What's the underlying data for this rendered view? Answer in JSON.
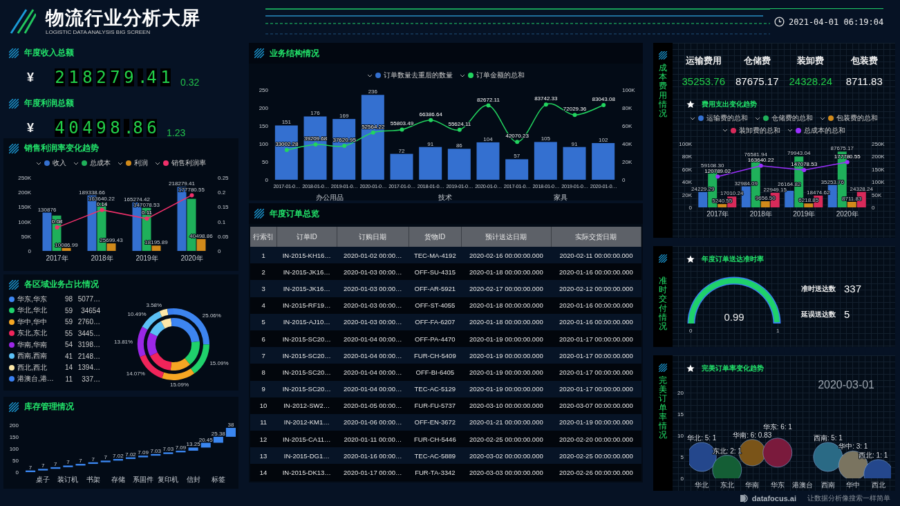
{
  "header": {
    "title": "物流行业分析大屏",
    "subtitle": "LOGISTIC DATA ANALYSIS BIG SCREEN",
    "datetime": "2021-04-01 06:19:04"
  },
  "kpis": [
    {
      "title": "年度收入总额",
      "currency": "¥",
      "value": "218279.41",
      "ratio": "0.32"
    },
    {
      "title": "年度利润总额",
      "currency": "¥",
      "value": "40498.86",
      "ratio": "1.23"
    }
  ],
  "sales_trend": {
    "title": "销售利润率变化趋势",
    "chart_data": {
      "type": "bar",
      "categories": [
        "2017年",
        "2018年",
        "2019年",
        "2020年"
      ],
      "ylim": [
        0,
        250000
      ],
      "yticks": [
        {
          "value": 0,
          "label": "0"
        },
        {
          "value": 50000,
          "label": "50K"
        },
        {
          "value": 100000,
          "label": "100K"
        },
        {
          "value": 150000,
          "label": "150K"
        },
        {
          "value": 200000,
          "label": "200K"
        },
        {
          "value": 250000,
          "label": "250K"
        }
      ],
      "y2lim": [
        0,
        0.25
      ],
      "y2ticks": [
        0,
        0.05,
        0.1,
        0.15,
        0.2,
        0.25
      ],
      "series": [
        {
          "name": "收入",
          "color": "#3470d0",
          "values": [
            130876,
            189338.66,
            165274.42,
            218279.41
          ],
          "value_labels": [
            "130876",
            "189338.66",
            "165274.42",
            "218279.41"
          ]
        },
        {
          "name": "总成本",
          "color": "#1fb05a",
          "values": [
            120789.02,
            163640.22,
            147078.53,
            177780.55
          ],
          "value_labels": [
            null,
            "163640.22",
            "147078.53",
            "177780.55"
          ]
        },
        {
          "name": "利润",
          "color": "#d18a1a",
          "values": [
            10086.99,
            25699.43,
            18195.89,
            40498.86
          ],
          "value_labels": [
            "10086.99",
            "25699.43",
            "18195.89",
            "40498.86"
          ]
        },
        {
          "name": "销售利润率",
          "type": "line",
          "axis": "y2",
          "marker": true,
          "color": "#f0306a",
          "values": [
            0.08,
            0.14,
            0.11,
            0.19
          ],
          "value_labels": [
            "0.08",
            "0.14",
            "0.11",
            null
          ]
        }
      ]
    }
  },
  "regions": {
    "title": "各区域业务占比情况",
    "items": [
      {
        "name": "华东,华东",
        "count": "98",
        "amount": "5077…",
        "color": "#3d85f0"
      },
      {
        "name": "华北,华北",
        "count": "59",
        "amount": "34654",
        "color": "#1fd16b"
      },
      {
        "name": "华中,华中",
        "count": "59",
        "amount": "2760…",
        "color": "#f5a623"
      },
      {
        "name": "东北,东北",
        "count": "55",
        "amount": "3445…",
        "color": "#f0245a"
      },
      {
        "name": "华南,华南",
        "count": "54",
        "amount": "3198…",
        "color": "#9b27e6"
      },
      {
        "name": "西南,西南",
        "count": "41",
        "amount": "2148…",
        "color": "#5bc0f5"
      },
      {
        "name": "西北,西北",
        "count": "14",
        "amount": "1394…",
        "color": "#fde8a8"
      },
      {
        "name": "港澳台,港…",
        "count": "11",
        "amount": "337…",
        "color": "#3a7ff0"
      }
    ],
    "chart_data": {
      "type": "donut",
      "series": [
        {
          "colors": [
            "#3d85f0",
            "#1fd16b",
            "#f5a623",
            "#f0245a",
            "#9b27e6",
            "#5bc0f5",
            "#fde8a8",
            "#3a7ff0"
          ],
          "values": [
            25.06,
            15.09,
            15.09,
            14.07,
            13.81,
            10.49,
            3.58,
            2.81
          ],
          "value_labels": [
            "25.06%",
            "15.09%",
            "15.09%",
            "14.07%",
            "13.81%",
            "10.49%",
            "3.58%",
            null
          ]
        },
        {
          "colors": [
            "#3d85f0",
            "#1fd16b",
            "#f5a623",
            "#f0245a",
            "#9b27e6",
            "#5bc0f5",
            "#fde8a8",
            "#3a7ff0"
          ],
          "values": [
            23.26,
            15.88,
            12.65,
            15.79,
            14.65,
            9.84,
            6.39,
            1.54
          ]
        }
      ]
    }
  },
  "inventory": {
    "title": "库存管理情况",
    "chart_data": {
      "type": "candlestick",
      "categories": [
        null,
        "桌子",
        null,
        "装订机",
        null,
        "书架",
        null,
        "存储",
        null,
        "系固件",
        null,
        "复印机",
        null,
        "信封",
        null,
        "标签",
        null
      ],
      "ylim": [
        0,
        200
      ],
      "yticks": [
        0,
        50,
        100,
        150,
        200
      ],
      "series": [
        {
          "color": "#3a86f0",
          "ohlc": [
            [
              0,
              7,
              0,
              7
            ],
            [
              7,
              14,
              7,
              14
            ],
            [
              14,
              21,
              14,
              21
            ],
            [
              21,
              28,
              21,
              28
            ],
            [
              28,
              35,
              28,
              35
            ],
            [
              35,
              42,
              35,
              42
            ],
            [
              42,
              49,
              42,
              49
            ],
            [
              49,
              56.02,
              49,
              56.02
            ],
            [
              56.02,
              63.04,
              56.02,
              63.04
            ],
            [
              63.04,
              70.13,
              63.04,
              70.13
            ],
            [
              70.13,
              77.16,
              70.13,
              77.16
            ],
            [
              77.16,
              84.19,
              77.16,
              84.19
            ],
            [
              84.19,
              91.28,
              84.19,
              91.28
            ],
            [
              91.28,
              104.53,
              91.28,
              104.53
            ],
            [
              104.53,
              124.98,
              104.53,
              124.98
            ],
            [
              124.98,
              150.36,
              124.98,
              150.36
            ],
            [
              150.36,
              188.36,
              150.36,
              188.36
            ]
          ],
          "value_labels": [
            "7",
            "7",
            "7",
            "7",
            "7",
            "7",
            "7",
            "7.02",
            "7.02",
            "7.09",
            "7.03",
            "7.03",
            "7.09",
            "13.25",
            "20.45",
            "25.38",
            "38"
          ]
        }
      ]
    }
  },
  "business": {
    "title": "业务结构情况",
    "groups": [
      "办公用品",
      "技术",
      "家具"
    ],
    "chart_data": {
      "type": "bar",
      "categories": [
        "2017-01-0…",
        "2018-01-0…",
        "2019-01-0…",
        "2020-01-0…",
        "2017-01-0…",
        "2018-01-0…",
        "2019-01-0…",
        "2020-01-0…",
        "2017-01-0…",
        "2018-01-0…",
        "2019-01-0…",
        "2020-01-0…"
      ],
      "ylim": [
        0,
        250
      ],
      "yticks": [
        0,
        50,
        100,
        150,
        200,
        250
      ],
      "y2lim": [
        0,
        100000
      ],
      "y2ticks": [
        {
          "value": 0,
          "label": "0"
        },
        {
          "value": 20000,
          "label": "20K"
        },
        {
          "value": 40000,
          "label": "40K"
        },
        {
          "value": 60000,
          "label": "60K"
        },
        {
          "value": 80000,
          "label": "80K"
        },
        {
          "value": 100000,
          "label": "100K"
        }
      ],
      "series": [
        {
          "name": "订单数量去重后的数量",
          "color": "#3470d0",
          "values": [
            151,
            176,
            169,
            236,
            72,
            91,
            86,
            104,
            57,
            105,
            91,
            102
          ],
          "value_labels": [
            "151",
            "176",
            "169",
            "236",
            "72",
            "91",
            "86",
            "104",
            "57",
            "105",
            "91",
            "102"
          ]
        },
        {
          "name": "订单金额的总和",
          "type": "line",
          "axis": "y2",
          "marker": true,
          "color": "#22d45f",
          "values": [
            33002.28,
            39209.68,
            37620.95,
            52564.22,
            55803.49,
            66386.64,
            55624.11,
            82672.11,
            42070.23,
            83742.33,
            72029.36,
            83043.08
          ],
          "value_labels": [
            "33002.28",
            "39209.68",
            "37620.95",
            "52564.22",
            "55803.49",
            "66386.64",
            "55624.11",
            "82672.11",
            "42070.23",
            "83742.33",
            "72029.36",
            "83043.08"
          ]
        }
      ]
    }
  },
  "orders": {
    "title": "年度订单总览",
    "columns": [
      "行索引",
      "订单ID",
      "订购日期",
      "货物ID",
      "预计送达日期",
      "实际交货日期"
    ],
    "rows": [
      [
        "1",
        "IN-2015-KH16…",
        "2020-01-02 00:00…",
        "TEC-MA-4192",
        "2020-02-16 00:00:00.000",
        "2020-02-11 00:00:00.000"
      ],
      [
        "2",
        "IN-2015-JK16…",
        "2020-01-03 00:00…",
        "OFF-SU-4315",
        "2020-01-18 00:00:00.000",
        "2020-01-16 00:00:00.000"
      ],
      [
        "3",
        "IN-2015-JK16…",
        "2020-01-03 00:00…",
        "OFF-AR-5921",
        "2020-02-17 00:00:00.000",
        "2020-02-12 00:00:00.000"
      ],
      [
        "4",
        "IN-2015-RF19…",
        "2020-01-03 00:00…",
        "OFF-ST-4055",
        "2020-01-18 00:00:00.000",
        "2020-01-16 00:00:00.000"
      ],
      [
        "5",
        "IN-2015-AJ10…",
        "2020-01-03 00:00…",
        "OFF-FA-6207",
        "2020-01-18 00:00:00.000",
        "2020-01-16 00:00:00.000"
      ],
      [
        "6",
        "IN-2015-SC20…",
        "2020-01-04 00:00…",
        "OFF-PA-4470",
        "2020-01-19 00:00:00.000",
        "2020-01-17 00:00:00.000"
      ],
      [
        "7",
        "IN-2015-SC20…",
        "2020-01-04 00:00…",
        "FUR-CH-5409",
        "2020-01-19 00:00:00.000",
        "2020-01-17 00:00:00.000"
      ],
      [
        "8",
        "IN-2015-SC20…",
        "2020-01-04 00:00…",
        "OFF-BI-6405",
        "2020-01-19 00:00:00.000",
        "2020-01-17 00:00:00.000"
      ],
      [
        "9",
        "IN-2015-SC20…",
        "2020-01-04 00:00…",
        "TEC-AC-5129",
        "2020-01-19 00:00:00.000",
        "2020-01-17 00:00:00.000"
      ],
      [
        "10",
        "IN-2012-SW2…",
        "2020-01-05 00:00…",
        "FUR-FU-5737",
        "2020-03-10 00:00:00.000",
        "2020-03-07 00:00:00.000"
      ],
      [
        "11",
        "IN-2012-KM1…",
        "2020-01-06 00:00…",
        "OFF-EN-3672",
        "2020-01-21 00:00:00.000",
        "2020-01-19 00:00:00.000"
      ],
      [
        "12",
        "IN-2015-CA11…",
        "2020-01-11 00:00…",
        "FUR-CH-5446",
        "2020-02-25 00:00:00.000",
        "2020-02-20 00:00:00.000"
      ],
      [
        "13",
        "IN-2015-DG1…",
        "2020-01-16 00:00…",
        "TEC-AC-5889",
        "2020-03-02 00:00:00.000",
        "2020-02-25 00:00:00.000"
      ],
      [
        "14",
        "IN-2015-DK13…",
        "2020-01-17 00:00…",
        "FUR-TA-3342",
        "2020-03-03 00:00:00.000",
        "2020-02-26 00:00:00.000"
      ]
    ]
  },
  "costs": {
    "title": "成本费用情况",
    "stats": [
      {
        "label": "运输费用",
        "value": "35253.76",
        "accent": true
      },
      {
        "label": "仓储费",
        "value": "87675.17",
        "accent": false
      },
      {
        "label": "装卸费",
        "value": "24328.24",
        "accent": true
      },
      {
        "label": "包装费",
        "value": "8711.83",
        "accent": false
      }
    ],
    "chart_title": "费用支出变化趋势",
    "chart_data": {
      "type": "bar",
      "categories": [
        "2017年",
        "2018年",
        "2019年",
        "2020年"
      ],
      "ylim": [
        0,
        100000
      ],
      "yticks": [
        {
          "value": 0,
          "label": "0"
        },
        {
          "value": 20000,
          "label": "20K"
        },
        {
          "value": 40000,
          "label": "40K"
        },
        {
          "value": 60000,
          "label": "60K"
        },
        {
          "value": 80000,
          "label": "80K"
        },
        {
          "value": 100000,
          "label": "100K"
        }
      ],
      "y2lim": [
        0,
        250000
      ],
      "y2ticks": [
        {
          "value": 0,
          "label": "0"
        },
        {
          "value": 50000,
          "label": "50K"
        },
        {
          "value": 100000,
          "label": "100K"
        },
        {
          "value": 150000,
          "label": "150K"
        },
        {
          "value": 200000,
          "label": "200K"
        },
        {
          "value": 250000,
          "label": "250K"
        }
      ],
      "series": [
        {
          "name": "运输费的总和",
          "color": "#3470d0",
          "values": [
            24229.29,
            32984.09,
            26164.82,
            35253.76
          ],
          "value_labels": [
            "24229.29",
            "32984.09",
            "26164.82",
            "35253.76"
          ]
        },
        {
          "name": "仓储费的总和",
          "color": "#1fb05a",
          "values": [
            59108.3,
            76581.94,
            79943.04,
            87675.17
          ],
          "value_labels": [
            "59108.30",
            "76581.94",
            "79943.04",
            "87675.17"
          ]
        },
        {
          "name": "包装费的总和",
          "color": "#d18a1a",
          "values": [
            5240.55,
            9656.5,
            6218.85,
            8711.83
          ],
          "value_labels": [
            "5240.55",
            "9656.50",
            "6218.85",
            "8711.83"
          ]
        },
        {
          "name": "装卸费的总和",
          "color": "#d82a5a",
          "values": [
            17010.24,
            22949.15,
            18474.62,
            24328.24
          ],
          "value_labels": [
            "17010.24",
            "22949.15",
            "18474.62",
            "24328.24"
          ]
        },
        {
          "name": "总成本的总和",
          "type": "line",
          "axis": "y2",
          "marker": true,
          "color": "#9b30ff",
          "values": [
            120789.02,
            163640.22,
            147078.53,
            177780.55
          ],
          "value_labels": [
            "120789.02",
            "163640.22",
            "147078.53",
            "177780.55"
          ]
        }
      ]
    }
  },
  "delivery": {
    "title": "准时交付情况",
    "chart_title": "年度订单送达准时率",
    "gauge": {
      "level": 0.99,
      "value": "0.99",
      "min": "0",
      "max": "1"
    },
    "counts": [
      {
        "label": "准时送达数",
        "value": "337"
      },
      {
        "label": "延误送达数",
        "value": "5"
      }
    ]
  },
  "perfect": {
    "title": "完美订单率情况",
    "chart_title": "完美订单率变化趋势",
    "date": "2020-03-01",
    "chart_data": {
      "type": "bubble",
      "categories": [
        "华北",
        "东北",
        "华南",
        "华东",
        "港澳台",
        "西南",
        "华中",
        "西北"
      ],
      "ylim": [
        0,
        20
      ],
      "yticks": [
        0,
        5,
        10,
        15,
        20
      ],
      "series": [
        {
          "colors": [
            "#24478c",
            "#145e35",
            "#7a5418",
            "#7a1a3c",
            null,
            "#2a6a85",
            "#7a7460",
            "#24478c"
          ],
          "values": [
            5,
            2,
            6,
            6,
            null,
            5,
            3,
            1
          ],
          "sizes": [
            1,
            1,
            0.83,
            1,
            null,
            1,
            1,
            1
          ],
          "value_labels": [
            "华北: 5: 1",
            "东北: 2: 1",
            "华南: 6: 0.83",
            "华东: 6: 1",
            null,
            "西南: 5: 1",
            "华中: 3: 1",
            "西北: 1: 1"
          ]
        }
      ]
    }
  },
  "footer": {
    "brand": "datafocus.ai",
    "tagline": "让数据分析像搜索一样简单"
  }
}
